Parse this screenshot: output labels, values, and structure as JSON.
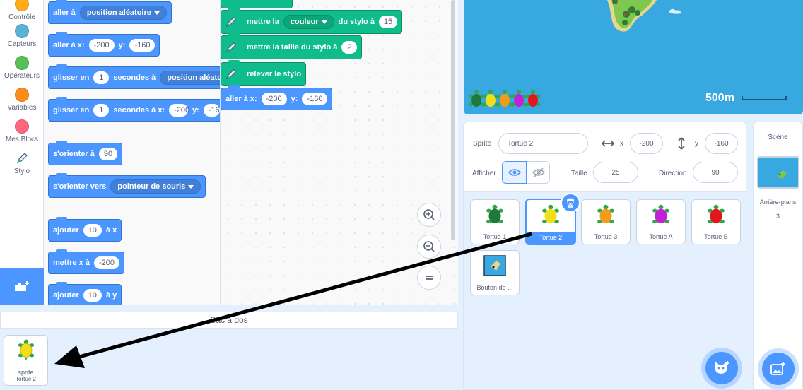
{
  "categories": [
    {
      "label": "Contrôle",
      "color": "#ffab19",
      "icon": "control-dot"
    },
    {
      "label": "Capteurs",
      "color": "#5cb1d6",
      "icon": "sensing-dot"
    },
    {
      "label": "Opérateurs",
      "color": "#59c059",
      "icon": "operators-dot"
    },
    {
      "label": "Variables",
      "color": "#ff8c1a",
      "icon": "variables-dot"
    },
    {
      "label": "Mes Blocs",
      "color": "#ff6680",
      "icon": "myblocks-dot"
    },
    {
      "label": "Stylo",
      "color": "#0fbd8c",
      "icon": "pen-icon"
    }
  ],
  "palette": {
    "goto_random": {
      "label": "aller à",
      "menu": "position aléatoire"
    },
    "goto_xy": {
      "label": "aller à x:",
      "x": "-200",
      "y_label": "y:",
      "y": "-160"
    },
    "glide_random": {
      "label": "glisser en",
      "secs": "1",
      "mid": "secondes à",
      "menu": "position aléatoire"
    },
    "glide_xy": {
      "label": "glisser en",
      "secs": "1",
      "mid": "secondes à x:",
      "x": "-200",
      "y_label": "y:",
      "y": "-16"
    },
    "point_direction": {
      "label": "s'orienter à",
      "value": "90"
    },
    "point_towards": {
      "label": "s'orienter vers",
      "menu": "pointeur de souris"
    },
    "change_x": {
      "label": "ajouter",
      "value": "10",
      "suffix": "à x"
    },
    "set_x": {
      "label": "mettre x à",
      "value": "-200"
    },
    "change_y": {
      "label": "ajouter",
      "value": "10",
      "suffix": "à y"
    }
  },
  "script": {
    "set_color": {
      "label": "mettre la",
      "menu": "couleur",
      "mid": "du stylo à",
      "value": "15"
    },
    "set_size": {
      "label": "mettre la taille du stylo à",
      "value": "2"
    },
    "pen_up": {
      "label": "relever le stylo"
    },
    "goto_xy": {
      "label": "aller à x:",
      "x": "-200",
      "y_label": "y:",
      "y": "-160"
    }
  },
  "backpack": {
    "title": "Sac à dos",
    "item": {
      "label": "sprite",
      "sublabel": "Tortue 2"
    }
  },
  "stage": {
    "scale_label": "500m",
    "turtle_colors": [
      "#1e7a3c",
      "#f1e019",
      "#f39c1b",
      "#c520d9",
      "#e0171c"
    ]
  },
  "sprite_info": {
    "sprite_label": "Sprite",
    "sprite_name": "Tortue 2",
    "x_label": "x",
    "x_value": "-200",
    "y_label": "y",
    "y_value": "-160",
    "show_label": "Afficher",
    "size_label": "Taille",
    "size_value": "25",
    "direction_label": "Direction",
    "direction_value": "90"
  },
  "sprites": [
    {
      "name": "Tortue 1",
      "color": "#1e7a3c"
    },
    {
      "name": "Tortue 2",
      "color": "#f1e019",
      "selected": true
    },
    {
      "name": "Tortue 3",
      "color": "#f39c1b"
    },
    {
      "name": "Tortue A",
      "color": "#c520d9"
    },
    {
      "name": "Tortue B",
      "color": "#e0171c"
    },
    {
      "name": "Bouton de ..."
    }
  ],
  "stage_panel": {
    "title": "Scène",
    "backdrops_label": "Arrière-plans",
    "backdrops_count": "3"
  }
}
